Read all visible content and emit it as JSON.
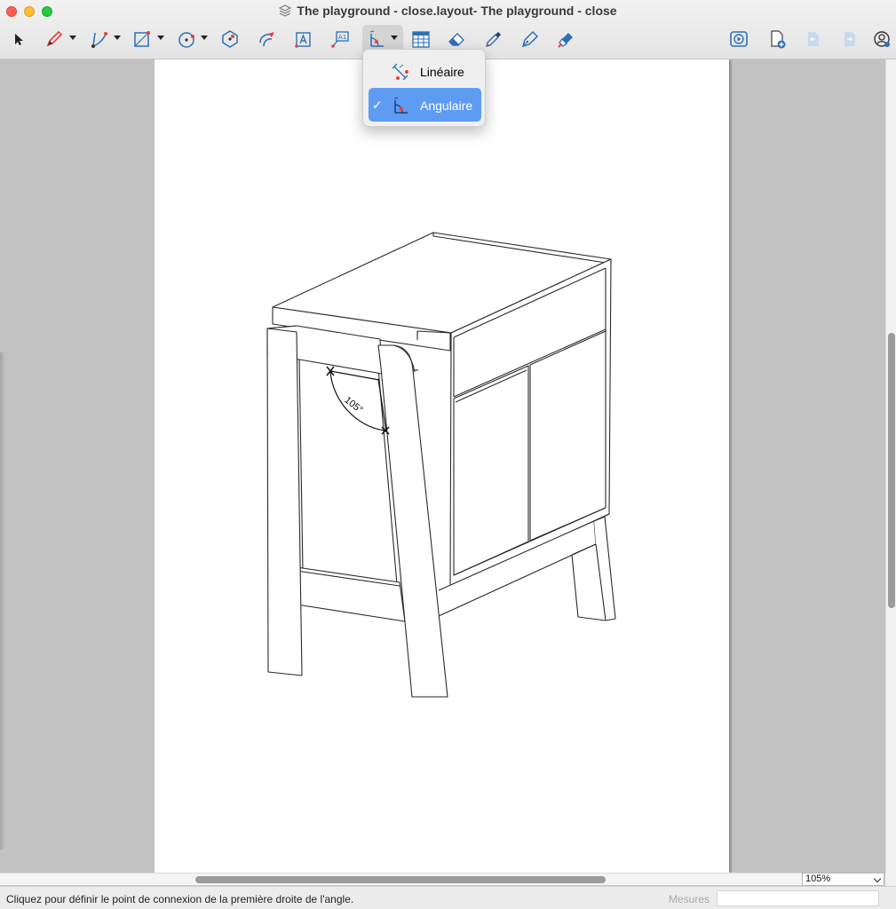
{
  "window": {
    "title": "The playground - close.layout- The playground - close"
  },
  "toolbar": {
    "tools": [
      {
        "name": "select-tool",
        "icon": "arrow-icon"
      },
      {
        "name": "pencil-tool",
        "icon": "pencil-icon"
      },
      {
        "name": "line-tool",
        "icon": "line-icon"
      },
      {
        "name": "rectangle-tool",
        "icon": "rectangle-icon"
      },
      {
        "name": "circle-tool",
        "icon": "circle-icon"
      },
      {
        "name": "polygon-tool",
        "icon": "polygon-icon"
      },
      {
        "name": "arc-tool",
        "icon": "arc-icon"
      },
      {
        "name": "text-tool",
        "icon": "text-icon"
      },
      {
        "name": "label-tool",
        "icon": "label-icon"
      },
      {
        "name": "dimension-tool",
        "icon": "dimension-icon"
      },
      {
        "name": "table-tool",
        "icon": "table-icon"
      },
      {
        "name": "eraser-tool",
        "icon": "eraser-icon"
      },
      {
        "name": "eyedropper-tool",
        "icon": "eyedropper-icon"
      },
      {
        "name": "style-tool",
        "icon": "pen-icon"
      },
      {
        "name": "paint-tool",
        "icon": "paint-icon"
      },
      {
        "name": "presentation-button",
        "icon": "play-icon"
      },
      {
        "name": "add-page-button",
        "icon": "add-page-icon"
      },
      {
        "name": "previous-page-button",
        "icon": "previous-page-icon"
      },
      {
        "name": "next-page-button",
        "icon": "next-page-icon"
      },
      {
        "name": "account-button",
        "icon": "account-icon"
      }
    ]
  },
  "dimension_menu": {
    "items": [
      {
        "label": "Linéaire",
        "selected": false
      },
      {
        "label": "Angulaire",
        "selected": true
      }
    ],
    "check": "✓"
  },
  "drawing": {
    "angle_label": "105°"
  },
  "zoom": {
    "value": "105%"
  },
  "status": {
    "message": "Cliquez pour définir le point de connexion de la première droite de l'angle.",
    "measures_label": "Mesures",
    "measures_value": ""
  },
  "colors": {
    "accent": "#5e9cf3",
    "tool_red": "#e8403a",
    "tool_blue": "#2e6fb8"
  }
}
